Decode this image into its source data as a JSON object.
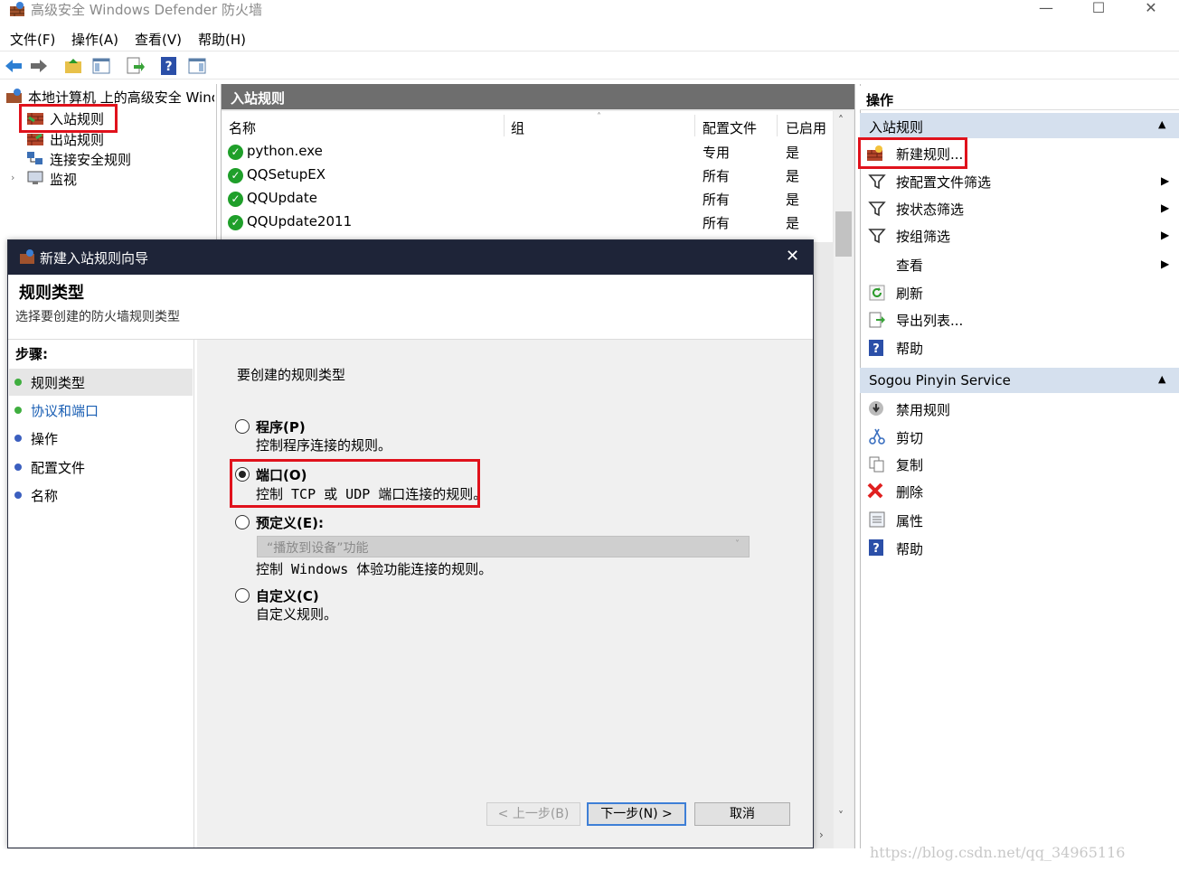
{
  "window": {
    "title": "高级安全 Windows Defender 防火墙",
    "controls": [
      "—",
      "☐",
      "✕"
    ]
  },
  "menu": [
    "文件(F)",
    "操作(A)",
    "查看(V)",
    "帮助(H)"
  ],
  "tree": {
    "root": "本地计算机 上的高级安全 Winc",
    "items": [
      "入站规则",
      "出站规则",
      "连接安全规则",
      "监视"
    ]
  },
  "middle": {
    "header": "入站规则",
    "columns": [
      "名称",
      "组",
      "配置文件",
      "已启用"
    ],
    "rows": [
      {
        "name": "python.exe",
        "group": "",
        "profile": "专用",
        "enabled": "是"
      },
      {
        "name": "QQSetupEX",
        "group": "",
        "profile": "所有",
        "enabled": "是"
      },
      {
        "name": "QQUpdate",
        "group": "",
        "profile": "所有",
        "enabled": "是"
      },
      {
        "name": "QQUpdate2011",
        "group": "",
        "profile": "所有",
        "enabled": "是"
      }
    ]
  },
  "actions": {
    "header": "操作",
    "section1": {
      "title": "入站规则",
      "items": [
        "新建规则...",
        "按配置文件筛选",
        "按状态筛选",
        "按组筛选",
        "查看",
        "刷新",
        "导出列表...",
        "帮助"
      ]
    },
    "section2": {
      "title": "Sogou Pinyin Service",
      "items": [
        "禁用规则",
        "剪切",
        "复制",
        "删除",
        "属性",
        "帮助"
      ]
    }
  },
  "dialog": {
    "title": "新建入站规则向导",
    "heading": "规则类型",
    "subheading": "选择要创建的防火墙规则类型",
    "steps_label": "步骤:",
    "steps": [
      "规则类型",
      "协议和端口",
      "操作",
      "配置文件",
      "名称"
    ],
    "prompt": "要创建的规则类型",
    "options": [
      {
        "title": "程序(P)",
        "desc": "控制程序连接的规则。"
      },
      {
        "title": "端口(O)",
        "desc": "控制 TCP 或 UDP 端口连接的规则。"
      },
      {
        "title": "预定义(E):",
        "desc": "控制 Windows 体验功能连接的规则。"
      },
      {
        "title": "自定义(C)",
        "desc": "自定义规则。"
      }
    ],
    "predefined_value": "“播放到设备”功能",
    "buttons": {
      "back": "< 上一步(B)",
      "next": "下一步(N) >",
      "cancel": "取消"
    }
  },
  "watermark": "https://blog.csdn.net/qq_34965116"
}
